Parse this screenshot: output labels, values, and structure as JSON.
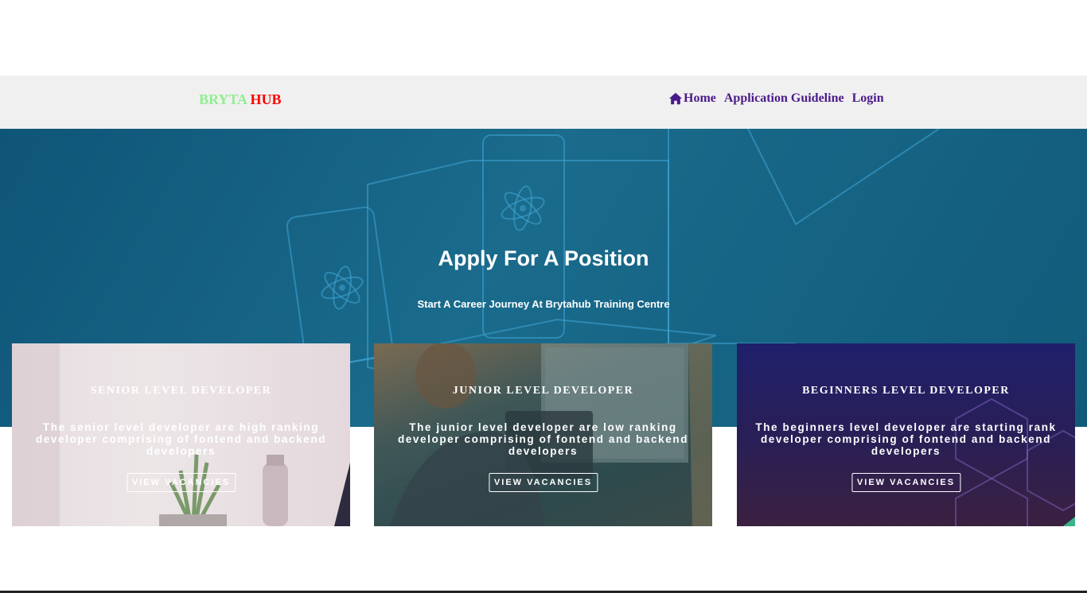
{
  "navbar": {
    "brand_part1": "BRYTA",
    "brand_part2": "HUB",
    "links": [
      {
        "label": "Home",
        "icon": "home-icon"
      },
      {
        "label": "Application Guideline"
      },
      {
        "label": "Login"
      }
    ]
  },
  "hero": {
    "title": "Apply For A Position",
    "subtitle": "Start A Career Journey At Brytahub Training Centre"
  },
  "cards": [
    {
      "title": "SENIOR LEVEL DEVELOPER",
      "description": "The senior level developer are high ranking developer comprising of fontend and backend developers",
      "button": "VIEW VACANCIES"
    },
    {
      "title": "JUNIOR LEVEL DEVELOPER",
      "description": "The junior level developer are low ranking developer comprising of fontend and backend developers",
      "button": "VIEW VACANCIES"
    },
    {
      "title": "BEGINNERS LEVEL DEVELOPER",
      "description": "The beginners level developer are starting rank developer comprising of fontend and backend developers",
      "button": "VIEW VACANCIES"
    }
  ],
  "colors": {
    "brand_part1": "#90ee90",
    "brand_part2": "#ff0000",
    "nav_link": "#4b1a8a",
    "hero_bg": "#1a6b8c"
  }
}
